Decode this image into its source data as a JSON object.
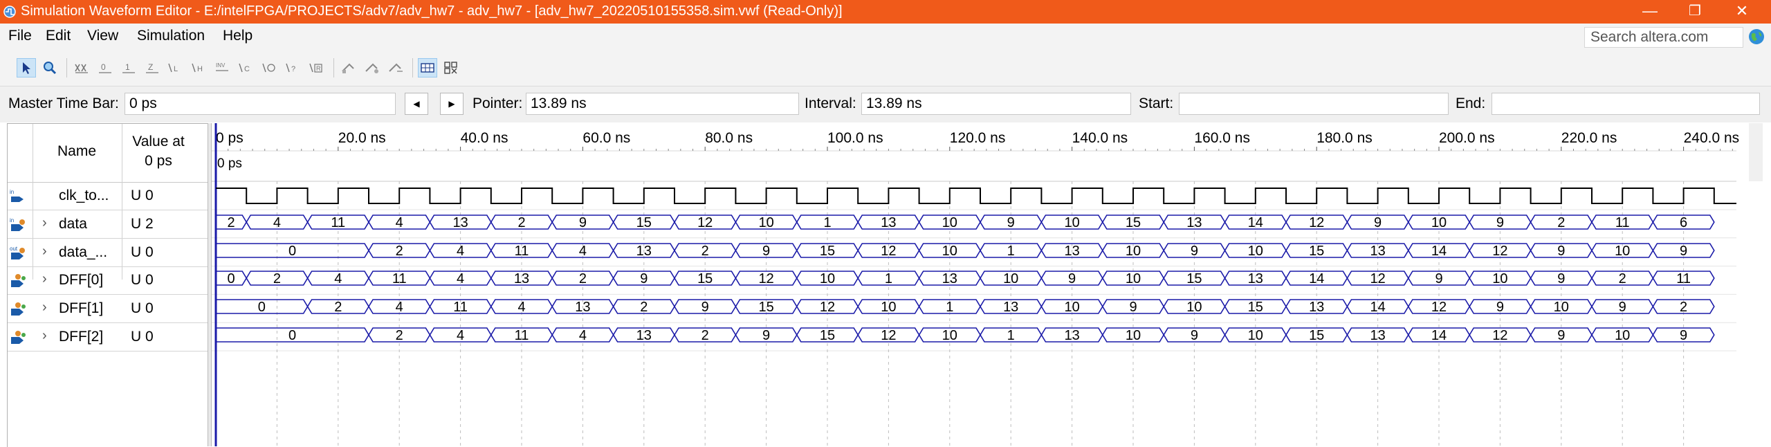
{
  "window": {
    "title": "Simulation Waveform Editor - E:/intelFPGA/PROJECTS/adv7/adv_hw7 - adv_hw7 - [adv_hw7_20220510155358.sim.vwf (Read-Only)]",
    "minimize": "—",
    "maximize": "❐",
    "close": "✕",
    "titlebar_color": "#f05a1a"
  },
  "menu": {
    "items": [
      "File",
      "Edit",
      "View",
      "Simulation",
      "Help"
    ],
    "search_placeholder": "Search altera.com"
  },
  "toolbar": {
    "buttons": [
      "selection-tool",
      "zoom-tool",
      "force-unknown",
      "force-low",
      "force-high",
      "force-high-impedance",
      "force-weak-low",
      "force-weak-high",
      "force-dont-care",
      "invert",
      "count-value",
      "overwrite-clock",
      "random-values",
      "overwrite-value",
      "snap-to-grid",
      "sort",
      "insert-node",
      "show-grid",
      "grid-settings"
    ]
  },
  "timebar": {
    "master_label": "Master Time Bar:",
    "master_value": "0 ps",
    "prev_icon": "◀",
    "next_icon": "▶",
    "pointer_label": "Pointer:",
    "pointer_value": "13.89 ns",
    "interval_label": "Interval:",
    "interval_value": "13.89 ns",
    "start_label": "Start:",
    "start_value": "",
    "end_label": "End:",
    "end_value": ""
  },
  "signals_header": {
    "name": "Name",
    "value_line1": "Value at",
    "value_line2": "0 ps"
  },
  "signals": [
    {
      "icon": "input-pin",
      "expand": "",
      "name": "clk_to...",
      "value": "U 0"
    },
    {
      "icon": "input-bus",
      "expand": "›",
      "name": "data",
      "value": "U 2"
    },
    {
      "icon": "output-bus",
      "expand": "›",
      "name": "data_...",
      "value": "U 0"
    },
    {
      "icon": "buried-bus",
      "expand": "›",
      "name": "DFF[0]",
      "value": "U 0"
    },
    {
      "icon": "buried-bus",
      "expand": "›",
      "name": "DFF[1]",
      "value": "U 0"
    },
    {
      "icon": "buried-bus",
      "expand": "›",
      "name": "DFF[2]",
      "value": "U 0"
    }
  ],
  "timeline": {
    "labels": [
      "0 ps",
      "20.0 ns",
      "40.0 ns",
      "60.0 ns",
      "80.0 ns",
      "100.0 ns",
      "120.0 ns",
      "140.0 ns",
      "160.0 ns",
      "180.0 ns",
      "200.0 ns",
      "220.0 ns",
      "240.0 ns"
    ],
    "cursor_label": "0 ps",
    "wave_color": "#1a1aa8",
    "clock_color": "#000000"
  },
  "waves": {
    "data": [
      "2",
      "4",
      "11",
      "4",
      "13",
      "2",
      "9",
      "15",
      "12",
      "10",
      "1",
      "13",
      "10",
      "9",
      "10",
      "15",
      "13",
      "14",
      "12",
      "9",
      "10",
      "9",
      "2",
      "11",
      "6"
    ],
    "data_out": [
      "0",
      "2",
      "4",
      "11",
      "4",
      "13",
      "2",
      "9",
      "15",
      "12",
      "10",
      "1",
      "13",
      "10",
      "9",
      "10",
      "15",
      "13",
      "14",
      "12",
      "9",
      "10",
      "9"
    ],
    "dff0": [
      "0",
      "2",
      "4",
      "11",
      "4",
      "13",
      "2",
      "9",
      "15",
      "12",
      "10",
      "1",
      "13",
      "10",
      "9",
      "10",
      "15",
      "13",
      "14",
      "12",
      "9",
      "10",
      "9",
      "2",
      "11"
    ],
    "dff1": [
      "0",
      "2",
      "4",
      "11",
      "4",
      "13",
      "2",
      "9",
      "15",
      "12",
      "10",
      "1",
      "13",
      "10",
      "9",
      "10",
      "15",
      "13",
      "14",
      "12",
      "9",
      "10",
      "9",
      "2"
    ],
    "dff2": [
      "0",
      "2",
      "4",
      "11",
      "4",
      "13",
      "2",
      "9",
      "15",
      "12",
      "10",
      "1",
      "13",
      "10",
      "9",
      "10",
      "15",
      "13",
      "14",
      "12",
      "9",
      "10",
      "9"
    ]
  }
}
